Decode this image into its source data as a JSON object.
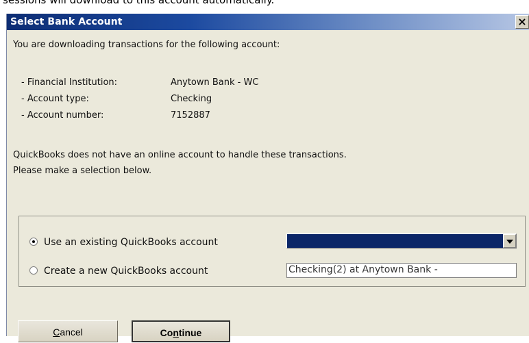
{
  "background": {
    "caption": "sessions will download to this account automatically."
  },
  "dialog": {
    "title": "Select Bank Account",
    "close_symbol": "×",
    "intro": "You are downloading transactions for the following account:",
    "details": [
      {
        "label": "- Financial Institution:",
        "value": "Anytown Bank - WC"
      },
      {
        "label": "- Account type:",
        "value": "Checking"
      },
      {
        "label": "- Account number:",
        "value": "7152887"
      }
    ],
    "message_line_1": "QuickBooks does not have an online account to handle these transactions.",
    "message_line_2": "Please make a selection below.",
    "options": {
      "existing": {
        "label": "Use an existing QuickBooks account",
        "selected": true
      },
      "create": {
        "label": "Create a new QuickBooks account",
        "selected": false,
        "field_value": "Checking(2) at Anytown Bank -"
      }
    },
    "buttons": {
      "cancel": {
        "mnemonic": "C",
        "rest": "ancel"
      },
      "continue": {
        "prefix": "Co",
        "mnemonic": "n",
        "suffix": "tinue"
      }
    },
    "colors": {
      "titlebar_start": "#0d2d74",
      "selection_highlight": "#0b2667",
      "dialog_background": "#ebe9db"
    }
  }
}
